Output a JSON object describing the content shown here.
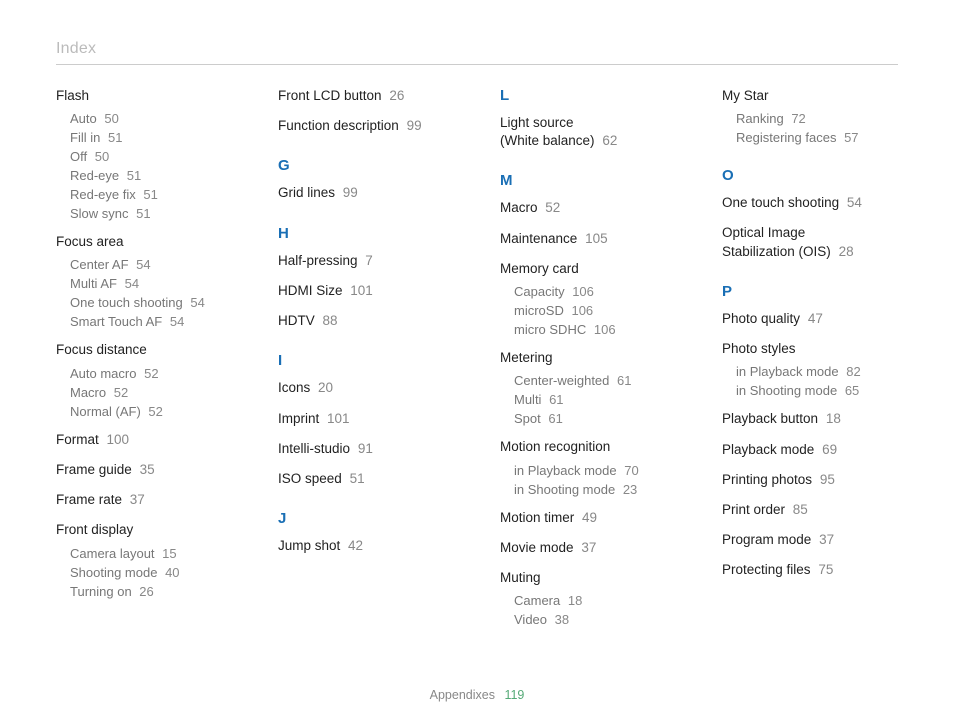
{
  "header": {
    "title": "Index"
  },
  "columns": [
    [
      {
        "type": "group",
        "label": "Flash",
        "sub": [
          {
            "t": "Auto",
            "p": "50"
          },
          {
            "t": "Fill in",
            "p": "51"
          },
          {
            "t": "Off",
            "p": "50"
          },
          {
            "t": "Red-eye",
            "p": "51"
          },
          {
            "t": "Red-eye fix",
            "p": "51"
          },
          {
            "t": "Slow sync",
            "p": "51"
          }
        ]
      },
      {
        "type": "group",
        "label": "Focus area",
        "sub": [
          {
            "t": "Center AF",
            "p": "54"
          },
          {
            "t": "Multi AF",
            "p": "54"
          },
          {
            "t": "One touch shooting",
            "p": "54"
          },
          {
            "t": "Smart Touch AF",
            "p": "54"
          }
        ]
      },
      {
        "type": "group",
        "label": "Focus distance",
        "sub": [
          {
            "t": "Auto macro",
            "p": "52"
          },
          {
            "t": "Macro",
            "p": "52"
          },
          {
            "t": "Normal (AF)",
            "p": "52"
          }
        ]
      },
      {
        "type": "entry",
        "label": "Format",
        "p": "100"
      },
      {
        "type": "entry",
        "label": "Frame guide",
        "p": "35"
      },
      {
        "type": "entry",
        "label": "Frame rate",
        "p": "37"
      },
      {
        "type": "group",
        "label": "Front display",
        "sub": [
          {
            "t": "Camera layout",
            "p": "15"
          },
          {
            "t": "Shooting mode",
            "p": "40"
          },
          {
            "t": "Turning on",
            "p": "26"
          }
        ]
      }
    ],
    [
      {
        "type": "entry",
        "label": "Front LCD button",
        "p": "26"
      },
      {
        "type": "entry",
        "label": "Function description",
        "p": "99"
      },
      {
        "type": "letter",
        "label": "G"
      },
      {
        "type": "entry",
        "label": "Grid lines",
        "p": "99"
      },
      {
        "type": "letter",
        "label": "H"
      },
      {
        "type": "entry",
        "label": "Half-pressing",
        "p": "7"
      },
      {
        "type": "entry",
        "label": "HDMI Size",
        "p": "101"
      },
      {
        "type": "entry",
        "label": "HDTV",
        "p": "88"
      },
      {
        "type": "letter",
        "label": "I"
      },
      {
        "type": "entry",
        "label": "Icons",
        "p": "20"
      },
      {
        "type": "entry",
        "label": "Imprint",
        "p": "101"
      },
      {
        "type": "entry",
        "label": "Intelli-studio",
        "p": "91"
      },
      {
        "type": "entry",
        "label": "ISO speed",
        "p": "51"
      },
      {
        "type": "letter",
        "label": "J"
      },
      {
        "type": "entry",
        "label": "Jump shot",
        "p": "42"
      }
    ],
    [
      {
        "type": "letter",
        "label": "L"
      },
      {
        "type": "entry2",
        "line1": "Light source",
        "line2": "(White balance)",
        "p": "62"
      },
      {
        "type": "letter",
        "label": "M"
      },
      {
        "type": "entry",
        "label": "Macro",
        "p": "52"
      },
      {
        "type": "entry",
        "label": "Maintenance",
        "p": "105"
      },
      {
        "type": "group",
        "label": "Memory card",
        "sub": [
          {
            "t": "Capacity",
            "p": "106"
          },
          {
            "t": "microSD",
            "p": "106"
          },
          {
            "t": "micro SDHC",
            "p": "106"
          }
        ]
      },
      {
        "type": "group",
        "label": "Metering",
        "sub": [
          {
            "t": "Center-weighted",
            "p": "61"
          },
          {
            "t": "Multi",
            "p": "61"
          },
          {
            "t": "Spot",
            "p": "61"
          }
        ]
      },
      {
        "type": "group",
        "label": "Motion recognition",
        "sub": [
          {
            "t": "in Playback mode",
            "p": "70"
          },
          {
            "t": "in Shooting mode",
            "p": "23"
          }
        ]
      },
      {
        "type": "entry",
        "label": "Motion timer",
        "p": "49"
      },
      {
        "type": "entry",
        "label": "Movie mode",
        "p": "37"
      },
      {
        "type": "group",
        "label": "Muting",
        "sub": [
          {
            "t": "Camera",
            "p": "18"
          },
          {
            "t": "Video",
            "p": "38"
          }
        ]
      }
    ],
    [
      {
        "type": "group",
        "label": "My Star",
        "sub": [
          {
            "t": "Ranking",
            "p": "72"
          },
          {
            "t": "Registering faces",
            "p": "57"
          }
        ]
      },
      {
        "type": "letter",
        "label": "O"
      },
      {
        "type": "entry",
        "label": "One touch shooting",
        "p": "54"
      },
      {
        "type": "entry2",
        "line1": "Optical Image",
        "line2": "Stabilization (OIS)",
        "p": "28"
      },
      {
        "type": "letter",
        "label": "P"
      },
      {
        "type": "entry",
        "label": "Photo quality",
        "p": "47"
      },
      {
        "type": "group",
        "label": "Photo styles",
        "sub": [
          {
            "t": "in Playback mode",
            "p": "82"
          },
          {
            "t": "in Shooting mode",
            "p": "65"
          }
        ]
      },
      {
        "type": "entry",
        "label": "Playback button",
        "p": "18"
      },
      {
        "type": "entry",
        "label": "Playback mode",
        "p": "69"
      },
      {
        "type": "entry",
        "label": "Printing photos",
        "p": "95"
      },
      {
        "type": "entry",
        "label": "Print order",
        "p": "85"
      },
      {
        "type": "entry",
        "label": "Program mode",
        "p": "37"
      },
      {
        "type": "entry",
        "label": "Protecting files",
        "p": "75"
      }
    ]
  ],
  "footer": {
    "section": "Appendixes",
    "page": "119"
  }
}
